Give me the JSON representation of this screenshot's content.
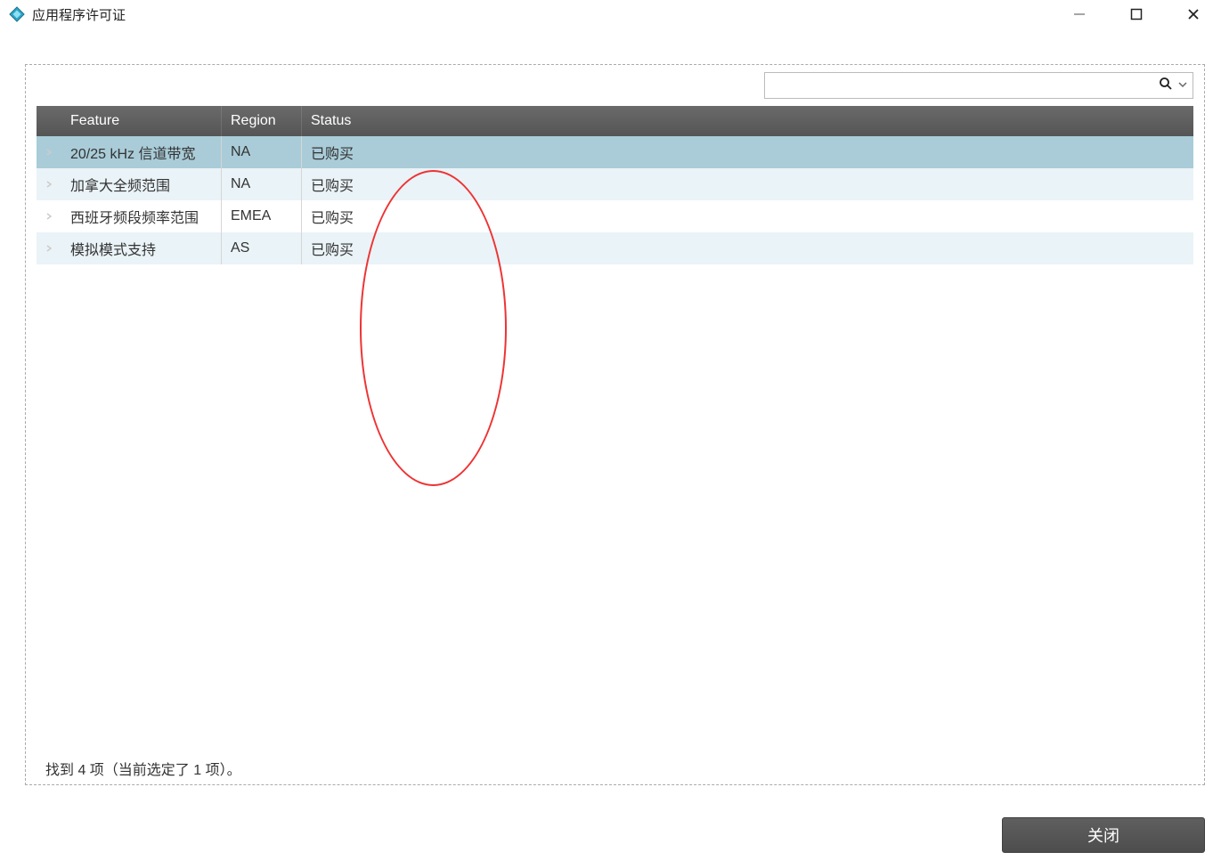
{
  "window": {
    "title": "应用程序许可证"
  },
  "search": {
    "value": "",
    "placeholder": ""
  },
  "table": {
    "headers": {
      "feature": "Feature",
      "region": "Region",
      "status": "Status"
    },
    "rows": [
      {
        "feature": "20/25 kHz 信道带宽",
        "region": "NA",
        "status": "已购买",
        "selected": true
      },
      {
        "feature": "加拿大全频范围",
        "region": "NA",
        "status": "已购买",
        "selected": false
      },
      {
        "feature": "西班牙频段频率范围",
        "region": "EMEA",
        "status": "已购买",
        "selected": false
      },
      {
        "feature": "模拟模式支持",
        "region": "AS",
        "status": "已购买",
        "selected": false
      }
    ]
  },
  "status_text": "找到 4 项（当前选定了 1 项）。",
  "buttons": {
    "close": "关闭"
  }
}
